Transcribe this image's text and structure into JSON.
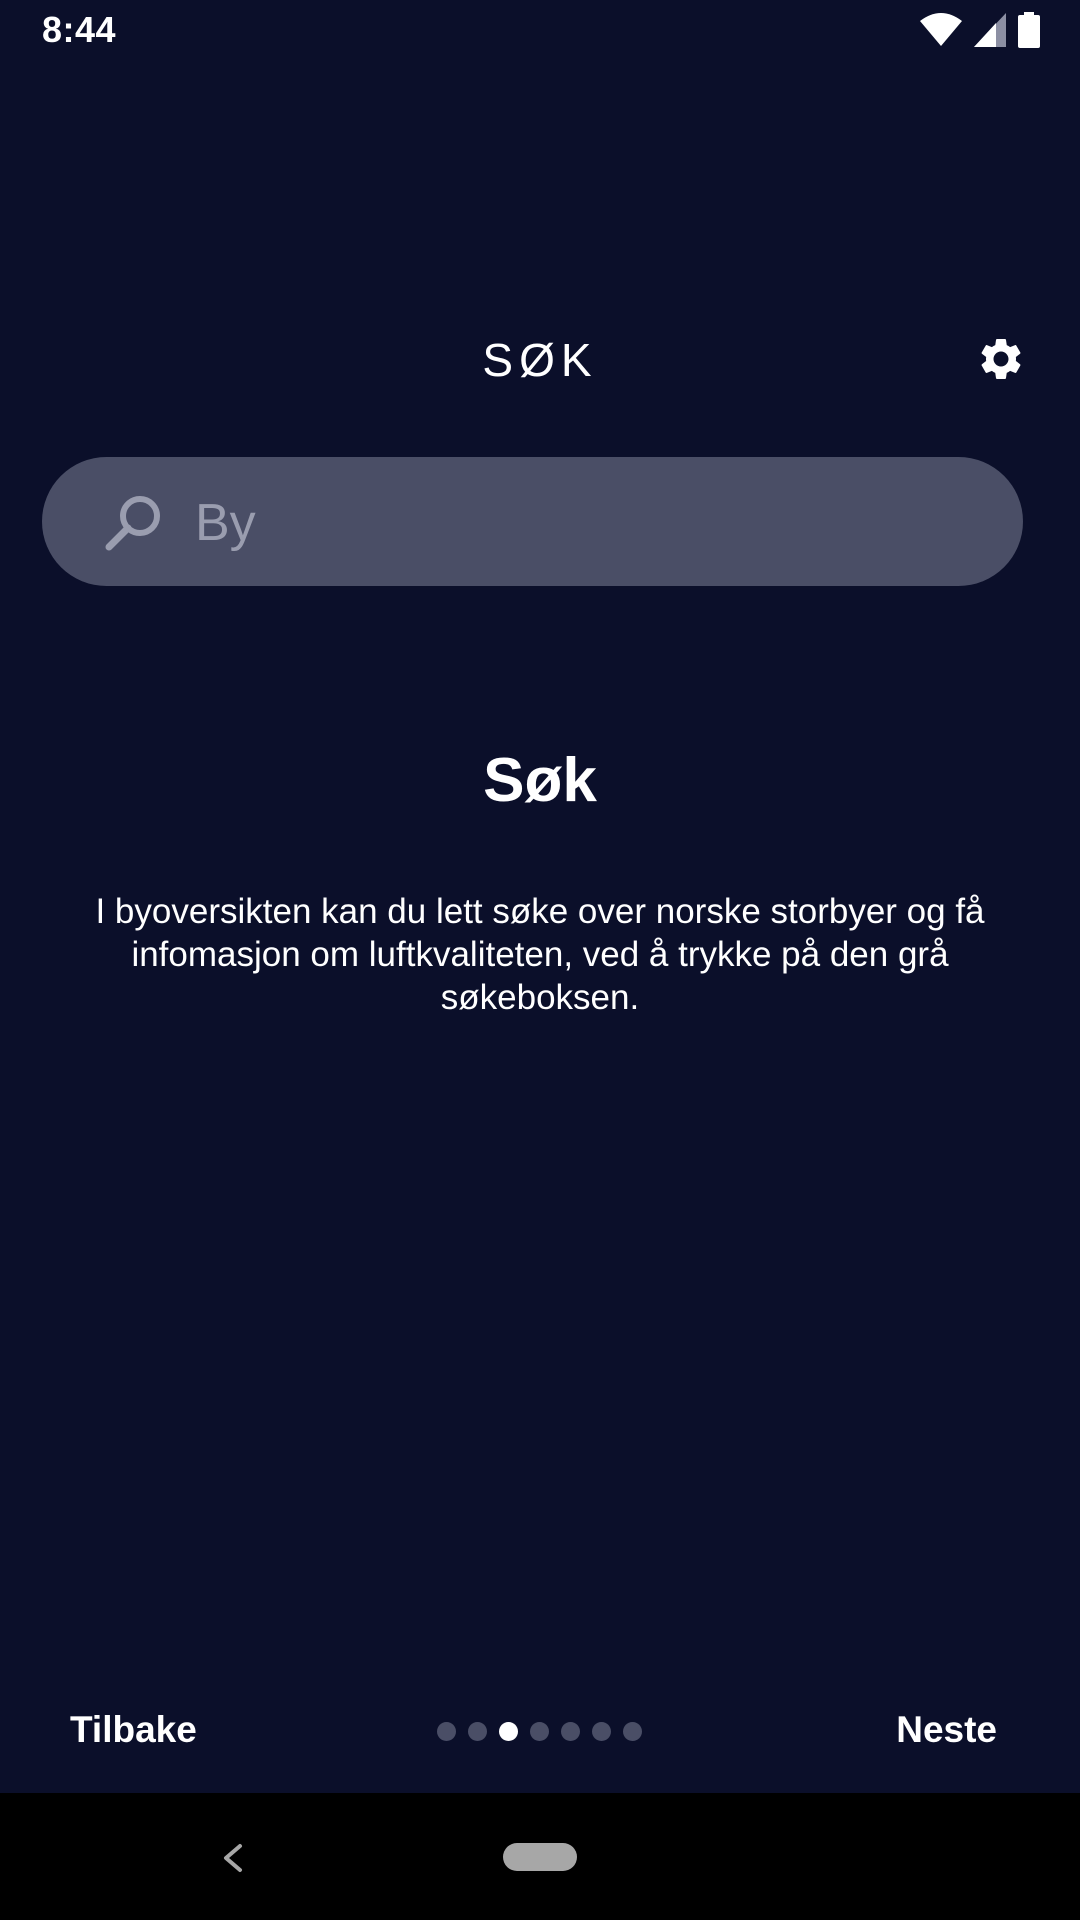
{
  "status_bar": {
    "time": "8:44",
    "icons": [
      "wifi-icon",
      "cell-signal-icon",
      "battery-icon"
    ]
  },
  "header": {
    "title": "SØK",
    "settings_icon": "gear-icon"
  },
  "search": {
    "placeholder": "By",
    "icon": "search-icon"
  },
  "content": {
    "title": "Søk",
    "description": "I byoversikten kan du lett søke over norske storbyer og få infomasjon om luftkvaliteten, ved å trykke på den grå søkeboksen."
  },
  "navigation": {
    "back_label": "Tilbake",
    "next_label": "Neste",
    "page_count": 7,
    "current_page": 3
  },
  "colors": {
    "background": "#0b0f2a",
    "search_box": "#4a4e66",
    "dot_inactive": "#4a4e66",
    "dot_active": "#ffffff",
    "text": "#ffffff"
  }
}
